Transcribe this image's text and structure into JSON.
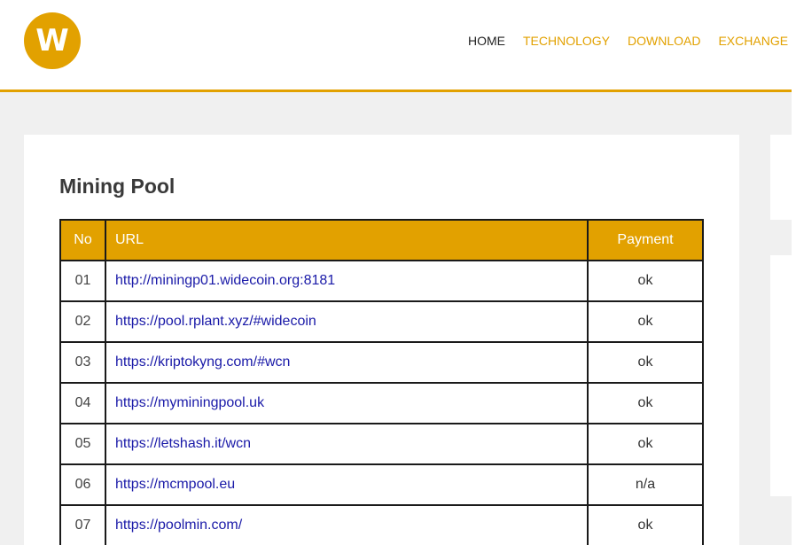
{
  "brand": {
    "logo_letter": "W",
    "accent": "#e2a100"
  },
  "nav": [
    {
      "label": "HOME",
      "active": true
    },
    {
      "label": "TECHNOLOGY",
      "active": false
    },
    {
      "label": "DOWNLOAD",
      "active": false
    },
    {
      "label": "EXCHANGE",
      "active": false
    }
  ],
  "main": {
    "title": "Mining Pool",
    "table": {
      "headers": {
        "no": "No",
        "url": "URL",
        "payment": "Payment"
      },
      "rows": [
        {
          "no": "01",
          "url": "http://miningp01.widecoin.org:8181",
          "payment": "ok"
        },
        {
          "no": "02",
          "url": "https://pool.rplant.xyz/#widecoin",
          "payment": "ok"
        },
        {
          "no": "03",
          "url": "https://kriptokyng.com/#wcn",
          "payment": "ok"
        },
        {
          "no": "04",
          "url": "https://myminingpool.uk",
          "payment": "ok"
        },
        {
          "no": "05",
          "url": "https://letshash.it/wcn",
          "payment": "ok"
        },
        {
          "no": "06",
          "url": "https://mcmpool.eu",
          "payment": "n/a"
        },
        {
          "no": "07",
          "url": "https://poolmin.com/",
          "payment": "ok"
        }
      ]
    }
  }
}
